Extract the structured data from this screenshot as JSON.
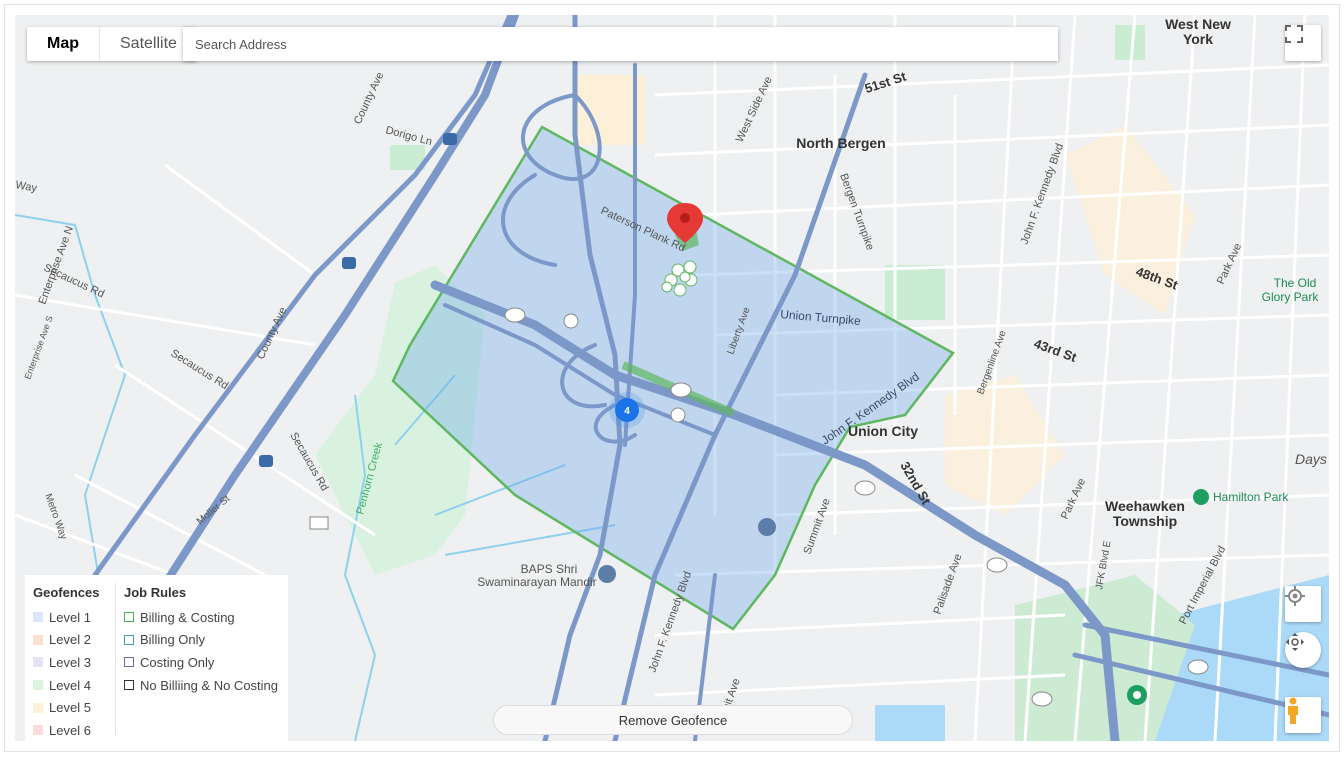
{
  "map_type": {
    "map_label": "Map",
    "satellite_label": "Satellite",
    "selected": "Map"
  },
  "search": {
    "placeholder": "Search Address"
  },
  "cluster_count": "4",
  "remove_geofence_label": "Remove Geofence",
  "legend": {
    "geofences_title": "Geofences",
    "levels": [
      {
        "label": "Level 1",
        "color": "#dbe7fb"
      },
      {
        "label": "Level 2",
        "color": "#fbe0cf"
      },
      {
        "label": "Level 3",
        "color": "#e4e2f6"
      },
      {
        "label": "Level 4",
        "color": "#dcf3df"
      },
      {
        "label": "Level 5",
        "color": "#fdf0d8"
      },
      {
        "label": "Level 6",
        "color": "#fbdcdc"
      }
    ],
    "job_rules_title": "Job Rules",
    "rules": [
      {
        "label": "Billing & Costing",
        "color": "#4caf50"
      },
      {
        "label": "Billing Only",
        "color": "#3aa0a8"
      },
      {
        "label": "Costing Only",
        "color": "#6a6a9a"
      },
      {
        "label": "No Billiing & No Costing",
        "color": "#333333"
      }
    ]
  },
  "map_labels": {
    "west_new_york": "West New",
    "west_new_york_2": "York",
    "north_bergen": "North Bergen",
    "union_city": "Union City",
    "weehawken": "Weehawken",
    "weehawken_2": "Township",
    "baps": "BAPS Shri",
    "baps_2": "Swaminarayan Mandir",
    "hamilton_park": "Hamilton Park",
    "the_old": "The Old",
    "glory_park": "Glory Park",
    "days_p": "Days P",
    "secaucus_rd": "Secaucus Rd",
    "secaucus_rd2": "Secaucus Rd",
    "secaucus_rd3": "Secaucus Rd",
    "county_ave": "County Ave",
    "county_ave2": "County Ave",
    "enterprise_ave_n": "Enterprise Ave N",
    "enterprise_ave_s": "Enterprise Ave S",
    "paterson_plank_rd": "Paterson Plank Rd",
    "union_turnpike": "Union Turnpike",
    "jfk_blvd": "John F. Kennedy Blvd",
    "jfk_blvd2": "John F. Kennedy Blvd",
    "jfk_blvd3": "John F. Kennedy Blvd",
    "bergen_turnpike": "Bergen Turnpike",
    "west_side_ave": "West Side Ave",
    "summit_ave": "Summit Ave",
    "summit_ave2": "Summit Ave",
    "park_ave": "Park Ave",
    "park_ave2": "Park Ave",
    "penhorn_creek": "Penhorn Creek",
    "51st_st": "51st St",
    "48th_st": "48th St",
    "43rd_st": "43rd St",
    "32nd_st": "32nd St",
    "dorigo_ln": "Dorigo Ln",
    "metro_way": "Metro Way",
    "moller_st": "Moller St",
    "liberty_ave": "Liberty Ave",
    "palisade_ave": "Palisade Ave",
    "bergenline_ave": "Bergenline Ave",
    "port_imperial_blvd": "Port Imperial Blvd",
    "jfk_blvd_e": "JFK Blvd E",
    "way": "Way"
  }
}
